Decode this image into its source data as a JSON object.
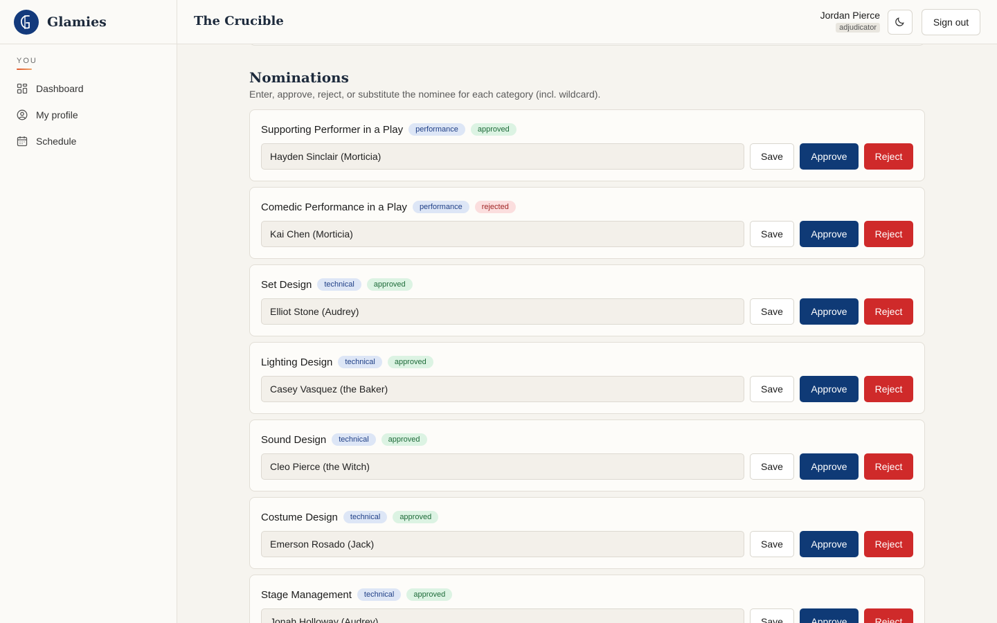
{
  "brand": {
    "name": "Glamies"
  },
  "sidebar": {
    "section_label": "YOU",
    "items": [
      {
        "label": "Dashboard",
        "icon": "grid-icon"
      },
      {
        "label": "My profile",
        "icon": "user-circle-icon"
      },
      {
        "label": "Schedule",
        "icon": "calendar-icon"
      }
    ]
  },
  "header": {
    "title": "The Crucible",
    "user_name": "Jordan Pierce",
    "user_role": "adjudicator",
    "theme_toggle_icon": "moon-icon",
    "signout_label": "Sign out"
  },
  "nominations": {
    "title": "Nominations",
    "subtitle": "Enter, approve, reject, or substitute the nominee for each category (incl. wildcard).",
    "save_label": "Save",
    "approve_label": "Approve",
    "reject_label": "Reject",
    "items": [
      {
        "category": "Supporting Performer in a Play",
        "type": "performance",
        "status": "approved",
        "nominee": "Hayden Sinclair (Morticia)"
      },
      {
        "category": "Comedic Performance in a Play",
        "type": "performance",
        "status": "rejected",
        "nominee": "Kai Chen (Morticia)"
      },
      {
        "category": "Set Design",
        "type": "technical",
        "status": "approved",
        "nominee": "Elliot Stone (Audrey)"
      },
      {
        "category": "Lighting Design",
        "type": "technical",
        "status": "approved",
        "nominee": "Casey Vasquez (the Baker)"
      },
      {
        "category": "Sound Design",
        "type": "technical",
        "status": "approved",
        "nominee": "Cleo Pierce (the Witch)"
      },
      {
        "category": "Costume Design",
        "type": "technical",
        "status": "approved",
        "nominee": "Emerson Rosado (Jack)"
      },
      {
        "category": "Stage Management",
        "type": "technical",
        "status": "approved",
        "nominee": "Jonah Holloway (Audrey)"
      }
    ]
  },
  "colors": {
    "primary": "#0f3a76",
    "danger": "#cf2a2a",
    "approved_bg": "#dcf3e3",
    "rejected_bg": "#fbdede",
    "type_bg": "#dde6f6"
  }
}
